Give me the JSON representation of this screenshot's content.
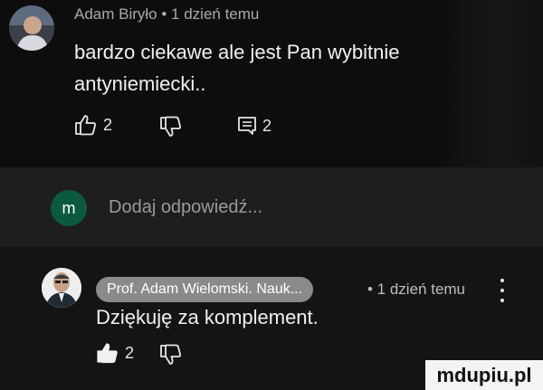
{
  "comment1": {
    "meta": "Adam Biryło • 1 dzień temu",
    "text": "bardzo ciekawe ale jest Pan wybitnie antyniemiecki..",
    "like_count": "2",
    "reply_count": "2"
  },
  "reply_box": {
    "avatar_letter": "m",
    "placeholder": "Dodaj odpowiedź..."
  },
  "comment2": {
    "author_chip": "Prof. Adam Wielomski. Nauk...",
    "meta": "• 1 dzień temu",
    "text": "Dziękuję za komplement.",
    "like_count": "2"
  },
  "watermark": "mdupiu.pl"
}
